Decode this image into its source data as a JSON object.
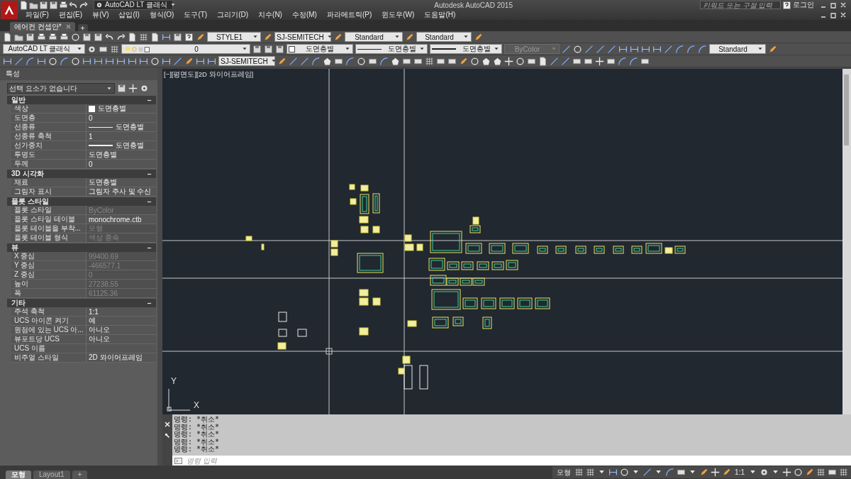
{
  "app": {
    "workspace": "AutoCAD LT 클래식",
    "title": "Autodesk AutoCAD 2015",
    "search": {
      "placeholder": "키워드 또는 구절 입력"
    },
    "login": "로그인"
  },
  "menu": [
    "파일(F)",
    "편집(E)",
    "뷰(V)",
    "삽입(I)",
    "형식(O)",
    "도구(T)",
    "그리기(D)",
    "치수(N)",
    "수정(M)",
    "파라메트릭(P)",
    "윈도우(W)",
    "도움말(H)"
  ],
  "document_tabs": [
    {
      "label": "에어컨 컨셉안*",
      "selected": true
    }
  ],
  "toolbar_rows": [
    {
      "dropdowns": [
        {
          "kind": "text",
          "value": "STYLE1",
          "disabled": false
        },
        {
          "kind": "text",
          "value": "SJ-SEMITECH",
          "disabled": false
        },
        {
          "kind": "text",
          "value": "Standard",
          "disabled": false
        },
        {
          "kind": "text",
          "value": "Standard",
          "disabled": false
        }
      ]
    },
    {
      "dropdowns": [
        {
          "kind": "text",
          "value": "AutoCAD LT 클래식",
          "disabled": false
        },
        {
          "kind": "layer",
          "value": "0",
          "disabled": false
        },
        {
          "kind": "swatch",
          "value": "도면층별",
          "disabled": false
        },
        {
          "kind": "line",
          "value": "도면층별",
          "disabled": false
        },
        {
          "kind": "thickline",
          "value": "도면층별",
          "disabled": false
        },
        {
          "kind": "text",
          "value": "ByColor",
          "disabled": true
        },
        {
          "kind": "text",
          "value": "Standard",
          "disabled": false
        }
      ]
    },
    {
      "dropdowns": [
        {
          "kind": "text",
          "value": "SJ-SEMITECH",
          "disabled": false
        }
      ]
    }
  ],
  "properties": {
    "title": "특성",
    "selection": "선택 요소가 없습니다",
    "sections": [
      {
        "title": "일반",
        "expanded": true,
        "rows": [
          {
            "label": "색상",
            "value": "도면층별",
            "kind": "swatch",
            "disabled": false
          },
          {
            "label": "도면층",
            "value": "0",
            "kind": "text",
            "disabled": false
          },
          {
            "label": "선종류",
            "value": "도면층별",
            "kind": "line",
            "disabled": false
          },
          {
            "label": "선종류 축척",
            "value": "1",
            "kind": "text",
            "disabled": false
          },
          {
            "label": "선가중치",
            "value": "도면층별",
            "kind": "thickline",
            "disabled": false
          },
          {
            "label": "투명도",
            "value": "도면층별",
            "kind": "text",
            "disabled": false
          },
          {
            "label": "두께",
            "value": "0",
            "kind": "text",
            "disabled": false
          }
        ]
      },
      {
        "title": "3D 시각화",
        "expanded": true,
        "rows": [
          {
            "label": "재료",
            "value": "도면층별",
            "kind": "text",
            "disabled": false
          },
          {
            "label": "그림자 표시",
            "value": "그림자 주사 및 수신",
            "kind": "text",
            "disabled": false
          }
        ]
      },
      {
        "title": "플롯 스타일",
        "expanded": true,
        "rows": [
          {
            "label": "플롯 스타일",
            "value": "ByColor",
            "kind": "text",
            "disabled": true
          },
          {
            "label": "플롯 스타일 테이블",
            "value": "monochrome.ctb",
            "kind": "text",
            "disabled": false
          },
          {
            "label": "플롯 테이블을 부착...",
            "value": "모형",
            "kind": "text",
            "disabled": true
          },
          {
            "label": "플롯 테이블 형식",
            "value": "색상 종속",
            "kind": "text",
            "disabled": true
          }
        ]
      },
      {
        "title": "뷰",
        "expanded": true,
        "rows": [
          {
            "label": "X 중심",
            "value": "99400.69",
            "kind": "text",
            "disabled": true
          },
          {
            "label": "Y 중심",
            "value": "-466577.1",
            "kind": "text",
            "disabled": true
          },
          {
            "label": "Z 중심",
            "value": "0",
            "kind": "text",
            "disabled": true
          },
          {
            "label": "높이",
            "value": "27238.55",
            "kind": "text",
            "disabled": true
          },
          {
            "label": "폭",
            "value": "61125.36",
            "kind": "text",
            "disabled": true
          }
        ]
      },
      {
        "title": "기타",
        "expanded": true,
        "rows": [
          {
            "label": "주석 축척",
            "value": "1:1",
            "kind": "text",
            "disabled": false
          },
          {
            "label": "UCS 아이콘 켜기",
            "value": "예",
            "kind": "text",
            "disabled": false
          },
          {
            "label": "원점에 있는 UCS 아...",
            "value": "아니오",
            "kind": "text",
            "disabled": false
          },
          {
            "label": "뷰포트당 UCS",
            "value": "아니오",
            "kind": "text",
            "disabled": false
          },
          {
            "label": "UCS 이름",
            "kind": "text",
            "disabled": false
          },
          {
            "label": "비주얼 스타일",
            "value": "2D 와이어프레임",
            "kind": "text",
            "disabled": false
          }
        ]
      }
    ]
  },
  "viewport": {
    "controls": [
      "[−]",
      "[평면도]",
      "[2D 와이어프레임]"
    ],
    "ucs": {
      "x": "X",
      "y": "Y"
    }
  },
  "command": {
    "history": [
      "명령: *취소*",
      "명령: *취소*",
      "명령: *취소*",
      "명령: *취소*",
      "명령: *취소*"
    ],
    "placeholder": "명령 입력"
  },
  "layout_tabs": [
    {
      "label": "모형",
      "selected": true
    },
    {
      "label": "Layout1",
      "selected": false
    },
    {
      "label": "+",
      "selected": false
    }
  ],
  "status_bar": {
    "space": "모형",
    "scale": "1:1"
  }
}
